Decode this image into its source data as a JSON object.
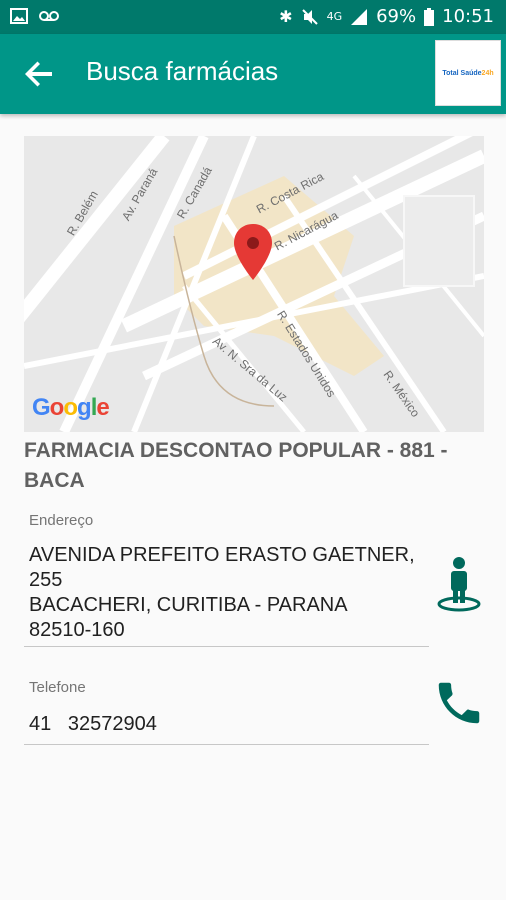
{
  "status_bar": {
    "battery": "69%",
    "time": "10:51",
    "network": "4G"
  },
  "app_bar": {
    "title": "Busca farmácias",
    "logo_text_a": "Total Saúde",
    "logo_text_b": "24h"
  },
  "map": {
    "google_logo": [
      "G",
      "o",
      "o",
      "g",
      "l",
      "e"
    ],
    "google_colors": [
      "#4285f4",
      "#ea4335",
      "#fbbc05",
      "#4285f4",
      "#34a853",
      "#ea4335"
    ],
    "streets": [
      "R. Belém",
      "Av. Paraná",
      "R. Canadá",
      "R. Costa Rica",
      "R. Nicarágua",
      "R. Estados Unidos",
      "Av. N. Sra da Luz",
      "R. México"
    ]
  },
  "pharmacy": {
    "name": "FARMACIA DESCONTAO POPULAR - 881 - BACA",
    "address_label": "Endereço",
    "address_lines": [
      "AVENIDA PREFEITO ERASTO GAETNER,",
      "255",
      "BACACHERI, CURITIBA - PARANA",
      "82510-160"
    ],
    "phone_label": "Telefone",
    "phone": "41   32572904"
  },
  "colors": {
    "primary": "#009688",
    "primary_dark": "#00796b",
    "accent": "#00695c",
    "pin": "#e53935"
  }
}
